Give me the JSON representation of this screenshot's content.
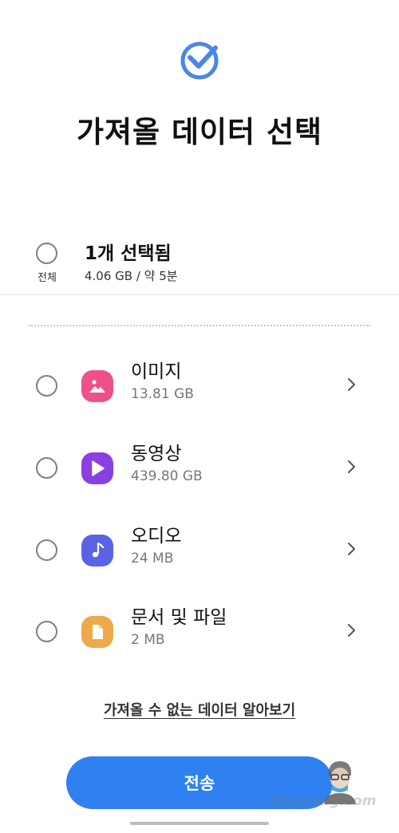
{
  "header": {
    "title": "가져올 데이터 선택",
    "icon": "check-badge-icon",
    "accent_color": "#4a86e8"
  },
  "select_all": {
    "label": "전체",
    "count_text": "1개 선택됨",
    "size_text": "4.06 GB / 약 5분"
  },
  "categories": [
    {
      "name": "이미지",
      "size": "13.81 GB",
      "icon": "image-icon",
      "color": "#f0508a"
    },
    {
      "name": "동영상",
      "size": "439.80 GB",
      "icon": "video-play-icon",
      "color": "#8a3fe0"
    },
    {
      "name": "오디오",
      "size": "24 MB",
      "icon": "music-note-icon",
      "color": "#5a63e6"
    },
    {
      "name": "문서 및 파일",
      "size": "2 MB",
      "icon": "document-icon",
      "color": "#eeaa4a"
    }
  ],
  "info_link": "가져올 수 없는 데이터 알아보기",
  "send_button": {
    "label": "전송",
    "color": "#2f80f0"
  },
  "watermark": {
    "text": "khaiyang.com"
  }
}
